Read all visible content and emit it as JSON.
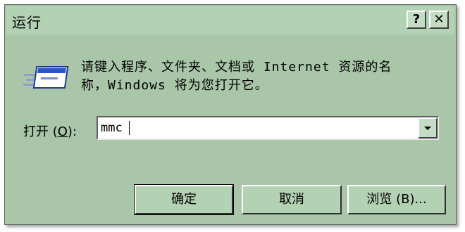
{
  "window": {
    "title": "运行",
    "help_label": "?",
    "close_label": "✕"
  },
  "icon": {
    "name": "run-icon"
  },
  "description": {
    "line1": "请键入程序、文件夹、文档或 Internet 资源的名",
    "line2": "称，Windows 将为您打开它。"
  },
  "open": {
    "label_prefix": "打开 (",
    "label_key": "O",
    "label_suffix": "):",
    "value": "mmc"
  },
  "buttons": {
    "ok": "确定",
    "cancel": "取消",
    "browse": "浏览 (B)..."
  },
  "colors": {
    "dialog_background": "#a9c6a9",
    "titlebar_background": "#b3d1b3"
  }
}
